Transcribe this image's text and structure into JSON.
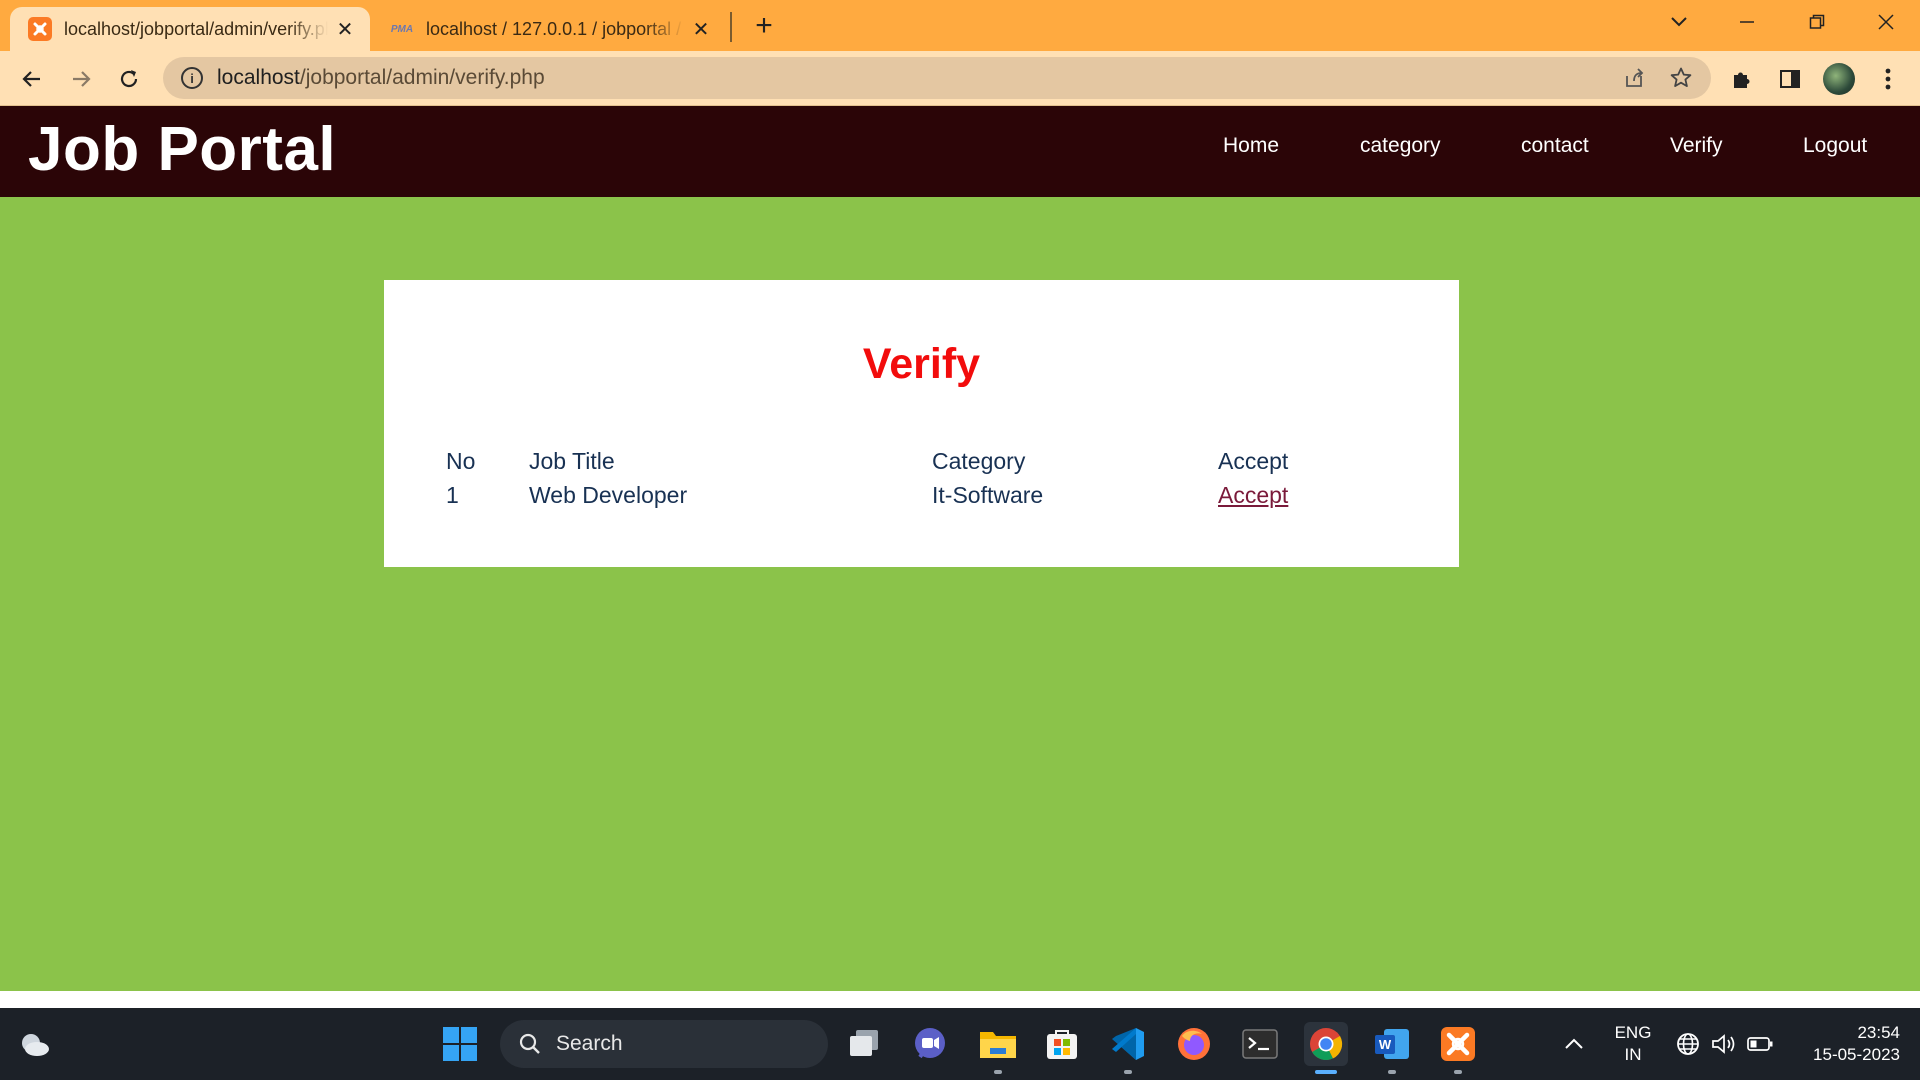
{
  "browser": {
    "tabs": [
      {
        "title": "localhost/jobportal/admin/verify.php",
        "favicon": "xampp-icon",
        "active": true
      },
      {
        "title": "localhost / 127.0.0.1 / jobportal / ",
        "favicon": "phpmyadmin-icon",
        "favicon_text": "PMA",
        "active": false
      }
    ],
    "url_host": "localhost",
    "url_path": "/jobportal/admin/verify.php",
    "accent_color": "#ffaa40"
  },
  "site": {
    "brand": "Job Portal",
    "nav": [
      "Home",
      "category",
      "contact",
      "Verify",
      "Logout"
    ],
    "header_color": "#2b0507",
    "background_color": "#8bc34a"
  },
  "verify": {
    "title": "Verify",
    "title_color": "#f20c0c",
    "columns": [
      "No",
      "Job Title",
      "Category",
      "Accept"
    ],
    "rows": [
      {
        "no": "1",
        "job_title": "Web Developer",
        "category": "It-Software",
        "action": "Accept"
      }
    ]
  },
  "taskbar": {
    "search_placeholder": "Search",
    "language_line1": "ENG",
    "language_line2": "IN",
    "time": "23:54",
    "date": "15-05-2023"
  }
}
